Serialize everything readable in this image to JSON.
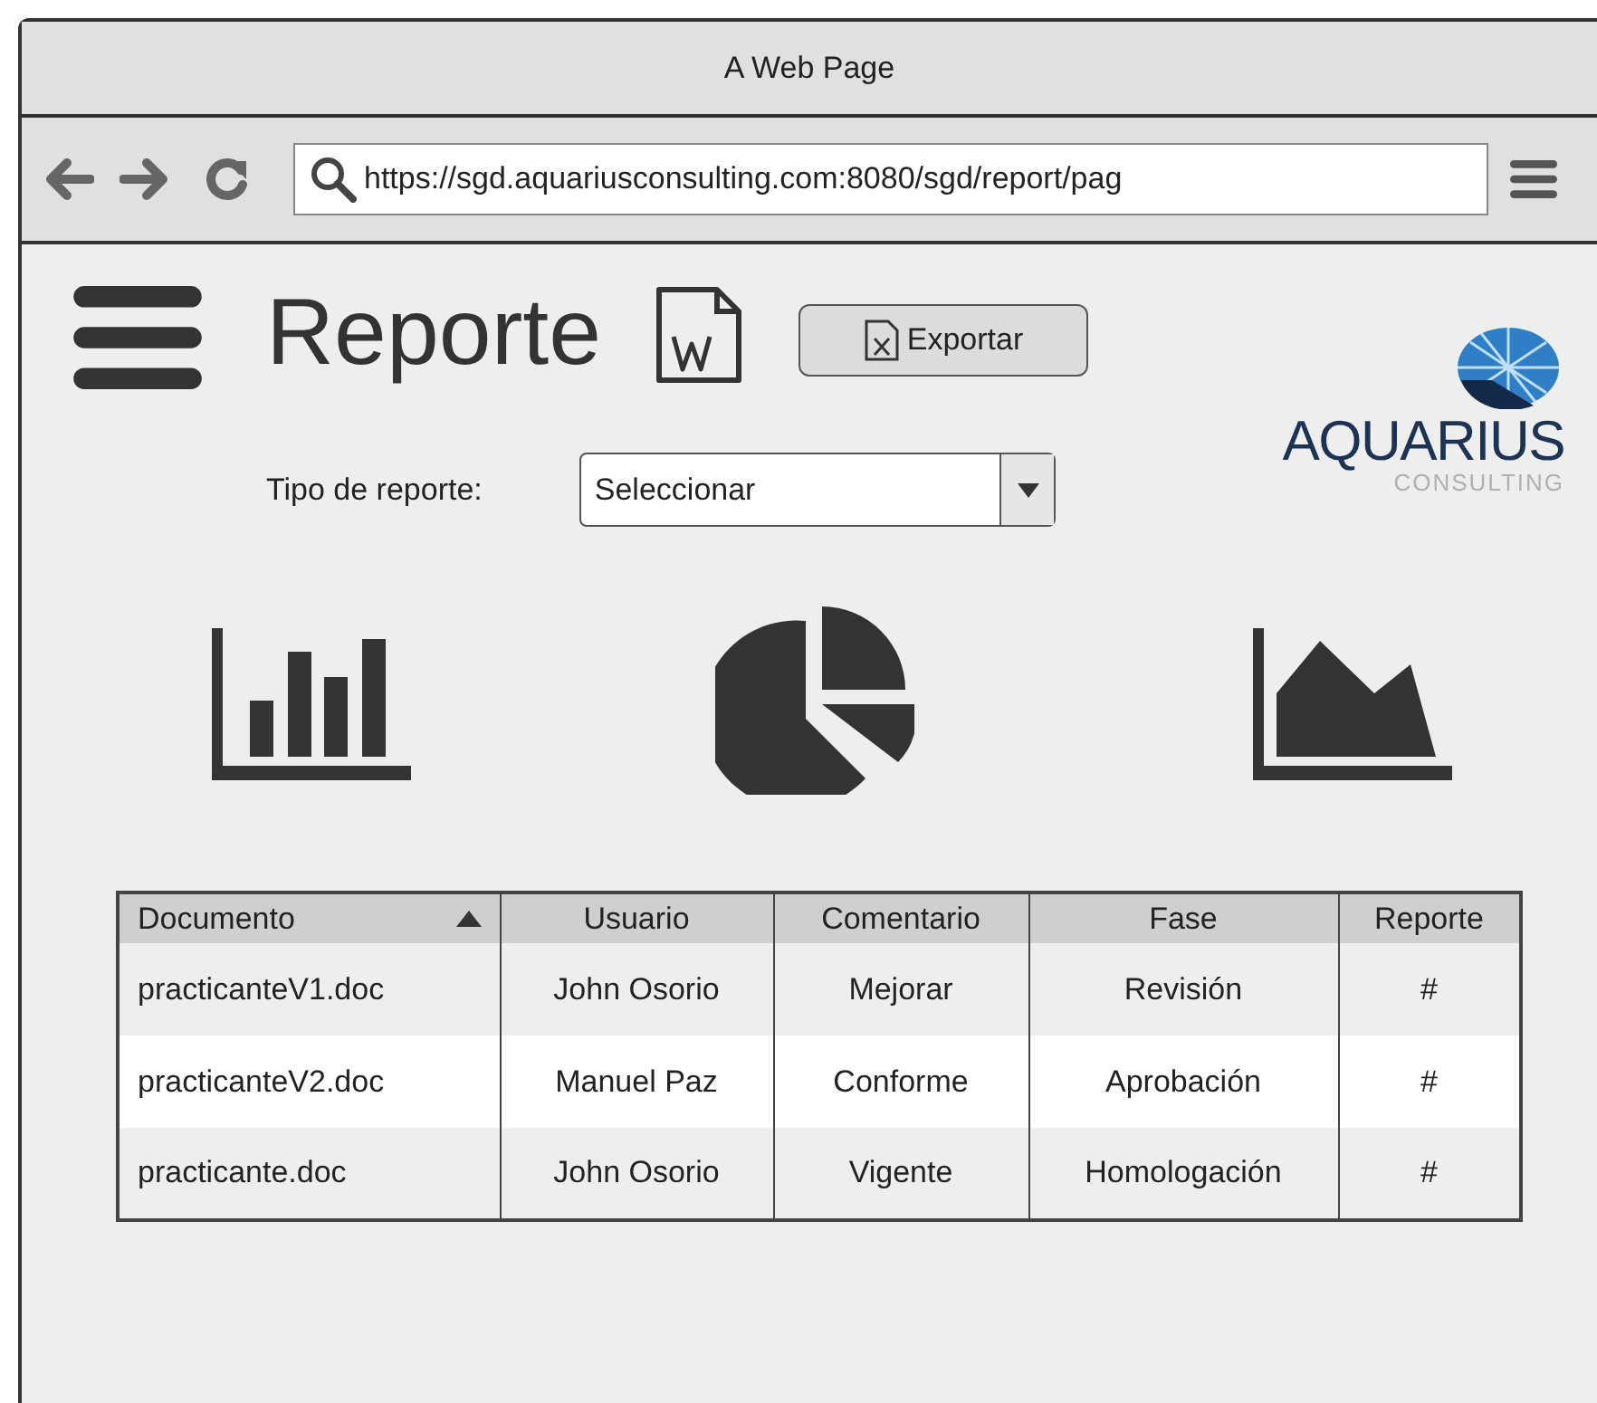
{
  "window": {
    "title": "A Web Page"
  },
  "address_bar": {
    "url": "https://sgd.aquariusconsulting.com:8080/sgd/report/pag"
  },
  "page": {
    "title": "Reporte",
    "export_button": "Exportar"
  },
  "logo": {
    "name": "AQUARIUS",
    "tagline": "CONSULTING"
  },
  "filter": {
    "label": "Tipo de reporte:",
    "value": "Seleccionar"
  },
  "table": {
    "columns": [
      {
        "label": "Documento",
        "sorted": true
      },
      {
        "label": "Usuario",
        "sorted": false
      },
      {
        "label": "Comentario",
        "sorted": false
      },
      {
        "label": "Fase",
        "sorted": false
      },
      {
        "label": "Reporte",
        "sorted": false
      }
    ],
    "rows": [
      [
        "practicanteV1.doc",
        "John Osorio",
        "Mejorar",
        "Revisión",
        "#"
      ],
      [
        "practicanteV2.doc",
        "Manuel Paz",
        "Conforme",
        "Aprobación",
        "#"
      ],
      [
        "practicante.doc",
        "John Osorio",
        "Vigente",
        "Homologación",
        "#"
      ]
    ]
  }
}
